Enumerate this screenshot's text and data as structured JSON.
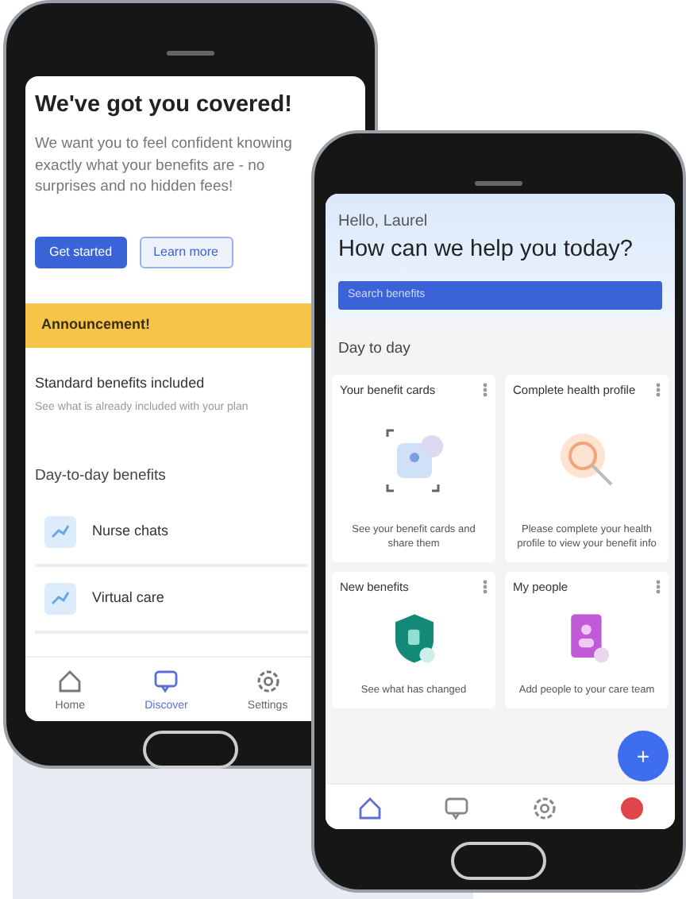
{
  "back_phone": {
    "title": "We've got you covered!",
    "intro": "We want you to feel confident knowing exactly what your benefits are - no surprises and no hidden fees!",
    "buttons": [
      {
        "label": "Get started",
        "kind": "primary"
      },
      {
        "label": "Learn more",
        "kind": "outline"
      }
    ],
    "banner": "Announcement!",
    "standard": {
      "title": "Standard benefits included",
      "subtitle": "See what is already included with your plan"
    },
    "section": "Day-to-day benefits",
    "benefits": [
      {
        "label": "Nurse chats"
      },
      {
        "label": "Virtual care"
      }
    ],
    "nav": [
      {
        "label": "Home",
        "kind": "home",
        "selected": false
      },
      {
        "label": "Discover",
        "kind": "chat",
        "selected": true
      },
      {
        "label": "Settings",
        "kind": "gear",
        "selected": false
      }
    ]
  },
  "front_phone": {
    "greeting": "Hello, Laurel",
    "title": "How can we help you today?",
    "search": {
      "placeholder": "Search benefits"
    },
    "section": "Day to day",
    "cards": [
      {
        "title": "Your benefit cards",
        "kind": "cards",
        "text": "See your benefit cards and share them"
      },
      {
        "title": "Complete health profile",
        "kind": "search",
        "text": "Please complete your health profile to view your benefit info"
      },
      {
        "title": "New benefits",
        "kind": "shield",
        "text": "See what has changed"
      },
      {
        "title": "My people",
        "kind": "person",
        "text": "Add people to your care team"
      }
    ],
    "fab": "+",
    "nav": [
      {
        "kind": "home",
        "selected": true
      },
      {
        "kind": "chat",
        "selected": false
      },
      {
        "kind": "gear",
        "selected": false
      },
      {
        "kind": "alert",
        "selected": false
      }
    ]
  }
}
